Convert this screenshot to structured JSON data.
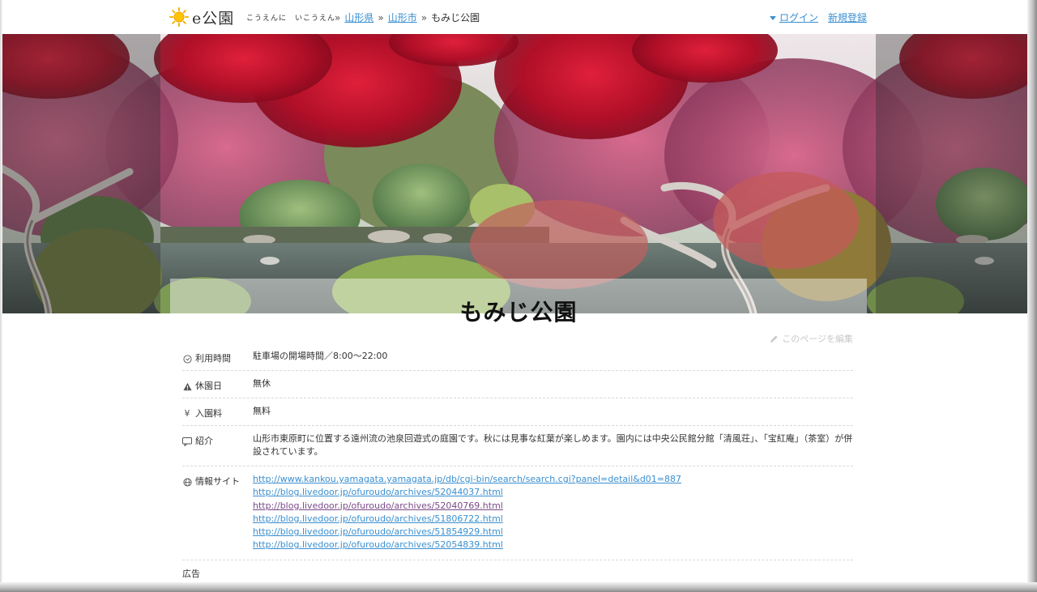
{
  "header": {
    "logo_text": "e公園",
    "tagline": "こうえんに　いこうえん",
    "breadcrumb": [
      {
        "label": "山形県",
        "link": true
      },
      {
        "label": "山形市",
        "link": true
      },
      {
        "label": "もみじ公園",
        "link": false
      }
    ],
    "separator": "»",
    "login_label": "ログイン",
    "register_label": "新規登録"
  },
  "hero": {
    "title": "もみじ公園"
  },
  "edit_label": "このページを編集",
  "info": {
    "hours_label": "利用時間",
    "hours_value": "駐車場の開場時間／8:00～22:00",
    "closed_label": "休園日",
    "closed_value": "無休",
    "fee_label": "入園料",
    "fee_value": "無料",
    "intro_label": "紹介",
    "intro_value": "山形市東原町に位置する遠州流の池泉回遊式の庭園です。秋には見事な紅葉が楽しめます。園内には中央公民館分館「清風荘」、「宝紅庵」（茶室）が併設されています。",
    "sites_label": "情報サイト",
    "sites": [
      "http://www.kankou.yamagata.yamagata.jp/db/cgi-bin/search/search.cgi?panel=detail&d01=887",
      "http://blog.livedoor.jp/ofuroudo/archives/52044037.html",
      "http://blog.livedoor.jp/ofuroudo/archives/52040769.html",
      "http://blog.livedoor.jp/ofuroudo/archives/51806722.html",
      "http://blog.livedoor.jp/ofuroudo/archives/51854929.html",
      "http://blog.livedoor.jp/ofuroudo/archives/52054839.html"
    ]
  },
  "ad_label": "広告",
  "colors": {
    "link": "#3a8fd0",
    "visited_link": "#7a4a8a",
    "maple_red": "#b8102a"
  }
}
